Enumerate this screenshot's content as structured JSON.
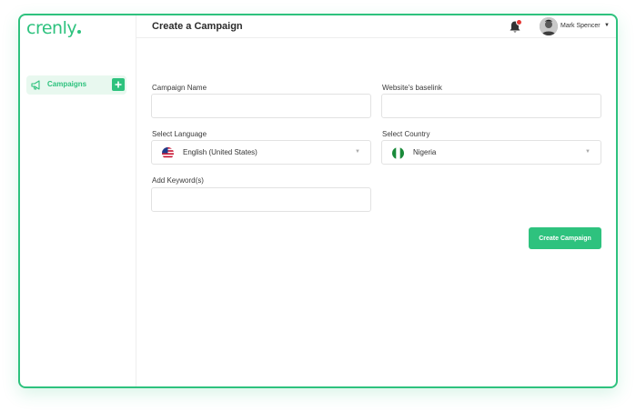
{
  "brand": {
    "logo_text": "crenly",
    "accent": "#2ec27e"
  },
  "sidebar": {
    "items": [
      {
        "label": "Campaigns",
        "icon": "megaphone-icon",
        "action_icon": "plus-icon"
      }
    ]
  },
  "header": {
    "title": "Create a Campaign",
    "notification_icon": "bell-icon",
    "notification_badge_color": "#e53935",
    "user_name": "Mark Spencer",
    "user_menu_icon": "caret-down-icon"
  },
  "form": {
    "campaign_name": {
      "label": "Campaign Name",
      "value": ""
    },
    "website_baselink": {
      "label": "Website's baselink",
      "value": ""
    },
    "language": {
      "label": "Select Language",
      "value": "English (United States)",
      "flag": "us-flag-icon"
    },
    "country": {
      "label": "Select Country",
      "value": "Nigeria",
      "flag": "nigeria-flag-icon"
    },
    "keywords": {
      "label": "Add Keyword(s)",
      "value": ""
    },
    "submit_label": "Create Campaign"
  }
}
